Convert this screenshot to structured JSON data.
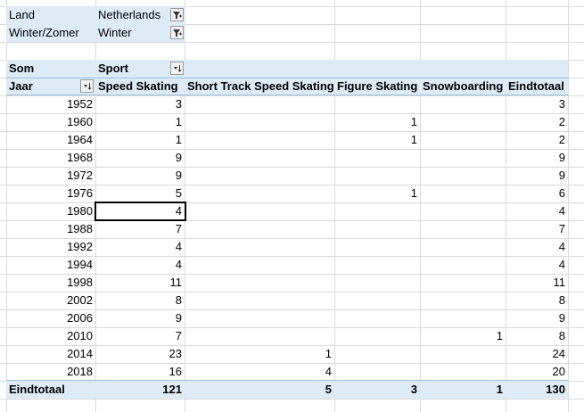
{
  "filters": [
    {
      "label": "Land",
      "value": "Netherlands"
    },
    {
      "label": "Winter/Zomer",
      "value": "Winter"
    }
  ],
  "pivot": {
    "values_label": "Som",
    "columns_label": "Sport",
    "rows_label": "Jaar",
    "column_headers": [
      "Speed Skating",
      "Short Track Speed Skating",
      "Figure Skating",
      "Snowboarding",
      "Eindtotaal"
    ],
    "rows": [
      {
        "year": "1952",
        "cells": [
          "3",
          "",
          "",
          "",
          "3"
        ]
      },
      {
        "year": "1960",
        "cells": [
          "1",
          "",
          "1",
          "",
          "2"
        ]
      },
      {
        "year": "1964",
        "cells": [
          "1",
          "",
          "1",
          "",
          "2"
        ]
      },
      {
        "year": "1968",
        "cells": [
          "9",
          "",
          "",
          "",
          "9"
        ]
      },
      {
        "year": "1972",
        "cells": [
          "9",
          "",
          "",
          "",
          "9"
        ]
      },
      {
        "year": "1976",
        "cells": [
          "5",
          "",
          "1",
          "",
          "6"
        ]
      },
      {
        "year": "1980",
        "cells": [
          "4",
          "",
          "",
          "",
          "4"
        ]
      },
      {
        "year": "1988",
        "cells": [
          "7",
          "",
          "",
          "",
          "7"
        ]
      },
      {
        "year": "1992",
        "cells": [
          "4",
          "",
          "",
          "",
          "4"
        ]
      },
      {
        "year": "1994",
        "cells": [
          "4",
          "",
          "",
          "",
          "4"
        ]
      },
      {
        "year": "1998",
        "cells": [
          "11",
          "",
          "",
          "",
          "11"
        ]
      },
      {
        "year": "2002",
        "cells": [
          "8",
          "",
          "",
          "",
          "8"
        ]
      },
      {
        "year": "2006",
        "cells": [
          "9",
          "",
          "",
          "",
          "9"
        ]
      },
      {
        "year": "2010",
        "cells": [
          "7",
          "",
          "",
          "1",
          "8"
        ]
      },
      {
        "year": "2014",
        "cells": [
          "23",
          "1",
          "",
          "",
          "24"
        ]
      },
      {
        "year": "2018",
        "cells": [
          "16",
          "4",
          "",
          "",
          "20"
        ]
      }
    ],
    "grand_total": {
      "label": "Eindtotaal",
      "cells": [
        "121",
        "5",
        "3",
        "1",
        "130"
      ]
    }
  },
  "icons": {
    "filter_applied": "filter-funnel-icon",
    "sort_dropdown": "sort-dropdown-icon"
  },
  "colors": {
    "header_fill": "#ddebf7",
    "header_border": "#9bc2e6",
    "grid": "#d9d9d9"
  }
}
